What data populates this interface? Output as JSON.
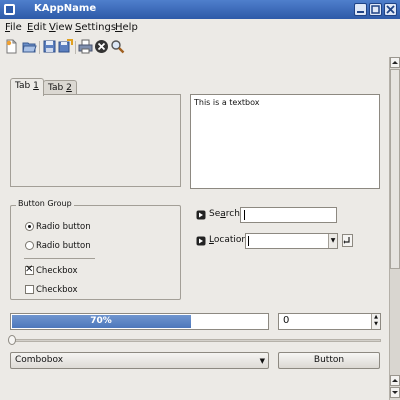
{
  "window": {
    "title": "KAppName"
  },
  "menu": [
    {
      "label": "File",
      "mnemonic": "F",
      "rest": "ile"
    },
    {
      "label": "Edit",
      "mnemonic": "E",
      "rest": "dit"
    },
    {
      "label": "View",
      "mnemonic": "V",
      "rest": "iew"
    },
    {
      "label": "Settings",
      "mnemonic": "S",
      "rest": "ettings"
    },
    {
      "label": "Help",
      "mnemonic": "H",
      "rest": "elp"
    }
  ],
  "toolbar": {
    "icons": [
      "new-document-icon",
      "open-folder-icon",
      "save-icon",
      "save-as-icon",
      "print-icon",
      "stop-icon",
      "find-icon"
    ]
  },
  "tabs": [
    {
      "label": "Tab 1",
      "prefix": "Tab ",
      "mnemonic": "1",
      "active": true
    },
    {
      "label": "Tab 2",
      "prefix": "Tab ",
      "mnemonic": "2",
      "active": false
    }
  ],
  "textbox": {
    "value": "This is a textbox"
  },
  "button_group": {
    "title": "Button Group",
    "radios": [
      {
        "label": "Radio button",
        "checked": true
      },
      {
        "label": "Radio button",
        "checked": false
      }
    ],
    "checkboxes": [
      {
        "label": "Checkbox",
        "checked": true
      },
      {
        "label": "Checkbox",
        "checked": false
      }
    ]
  },
  "form": {
    "search": {
      "label": "Search:",
      "pre": "Se",
      "mnemonic": "a",
      "post": "rch:",
      "value": ""
    },
    "location": {
      "label": "Location:",
      "pre": "",
      "mnemonic": "L",
      "post": "ocation:",
      "value": ""
    }
  },
  "progress": {
    "value": 0.7,
    "text": "70%"
  },
  "spinbox": {
    "value": "0"
  },
  "slider": {
    "value": 0
  },
  "combobox": {
    "value": "Combobox"
  },
  "button": {
    "label": "Button"
  },
  "colors": {
    "accent": "#4d77bb",
    "titlebar": "#2d5aa8",
    "background": "#eceae6"
  }
}
